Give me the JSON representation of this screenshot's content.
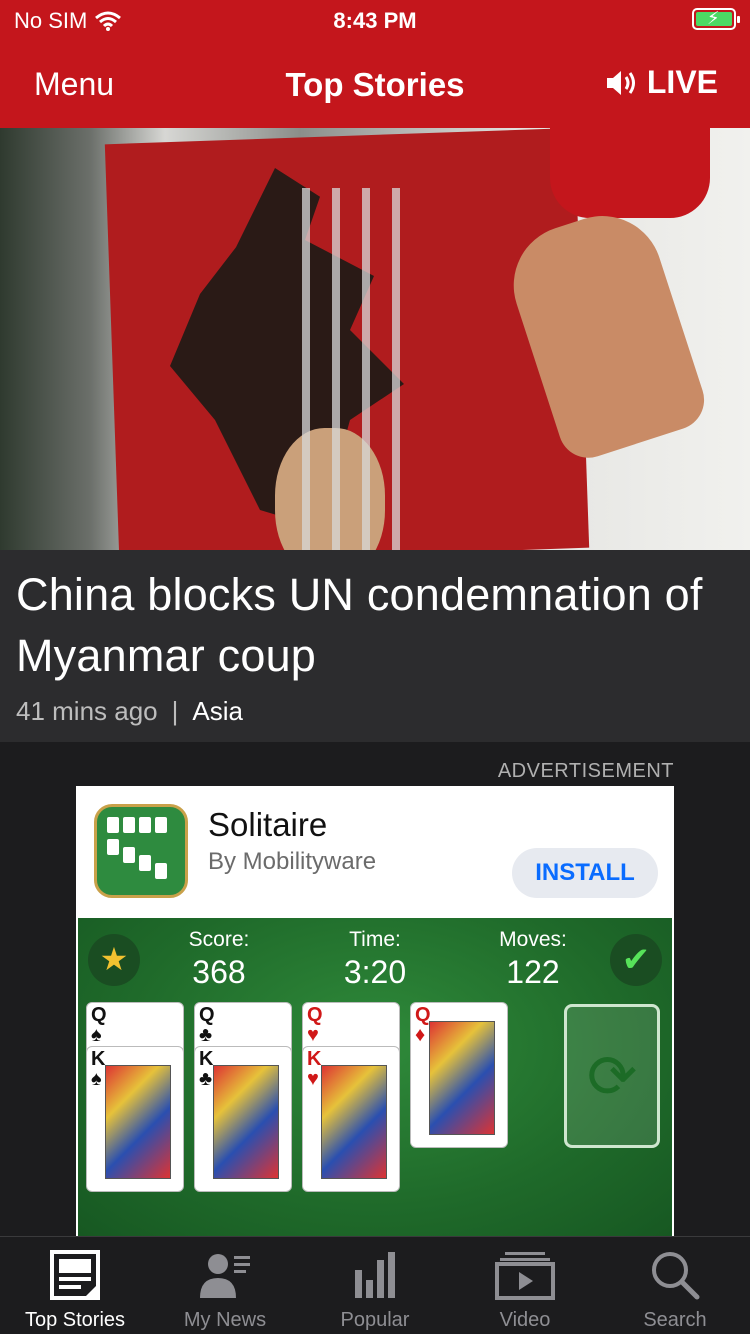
{
  "status_bar": {
    "carrier": "No SIM",
    "time": "8:43 PM"
  },
  "header": {
    "menu_label": "Menu",
    "title": "Top Stories",
    "live_label": "LIVE"
  },
  "story": {
    "headline": "China blocks UN condemnation of Myanmar coup",
    "age": "41 mins ago",
    "separator": "|",
    "section": "Asia"
  },
  "ad": {
    "label": "ADVERTISEMENT",
    "app_name": "Solitaire",
    "developer": "By Mobilityware",
    "install_label": "INSTALL",
    "game": {
      "score_label": "Score:",
      "score_value": "368",
      "time_label": "Time:",
      "time_value": "3:20",
      "moves_label": "Moves:",
      "moves_value": "122",
      "cards": [
        {
          "rank": "Q",
          "suit": "♠"
        },
        {
          "rank": "K",
          "suit": "♠"
        },
        {
          "rank": "Q",
          "suit": "♣"
        },
        {
          "rank": "K",
          "suit": "♣"
        },
        {
          "rank": "Q",
          "suit": "♥"
        },
        {
          "rank": "K",
          "suit": "♥"
        },
        {
          "rank": "Q",
          "suit": "♦"
        }
      ]
    }
  },
  "tabs": [
    {
      "label": "Top Stories",
      "icon": "top-stories-icon",
      "active": true
    },
    {
      "label": "My News",
      "icon": "my-news-icon",
      "active": false
    },
    {
      "label": "Popular",
      "icon": "popular-icon",
      "active": false
    },
    {
      "label": "Video",
      "icon": "video-icon",
      "active": false
    },
    {
      "label": "Search",
      "icon": "search-icon",
      "active": false
    }
  ],
  "colors": {
    "brand_red": "#c4161c",
    "accent_blue": "#0a6cff",
    "battery_green": "#4cd964"
  }
}
